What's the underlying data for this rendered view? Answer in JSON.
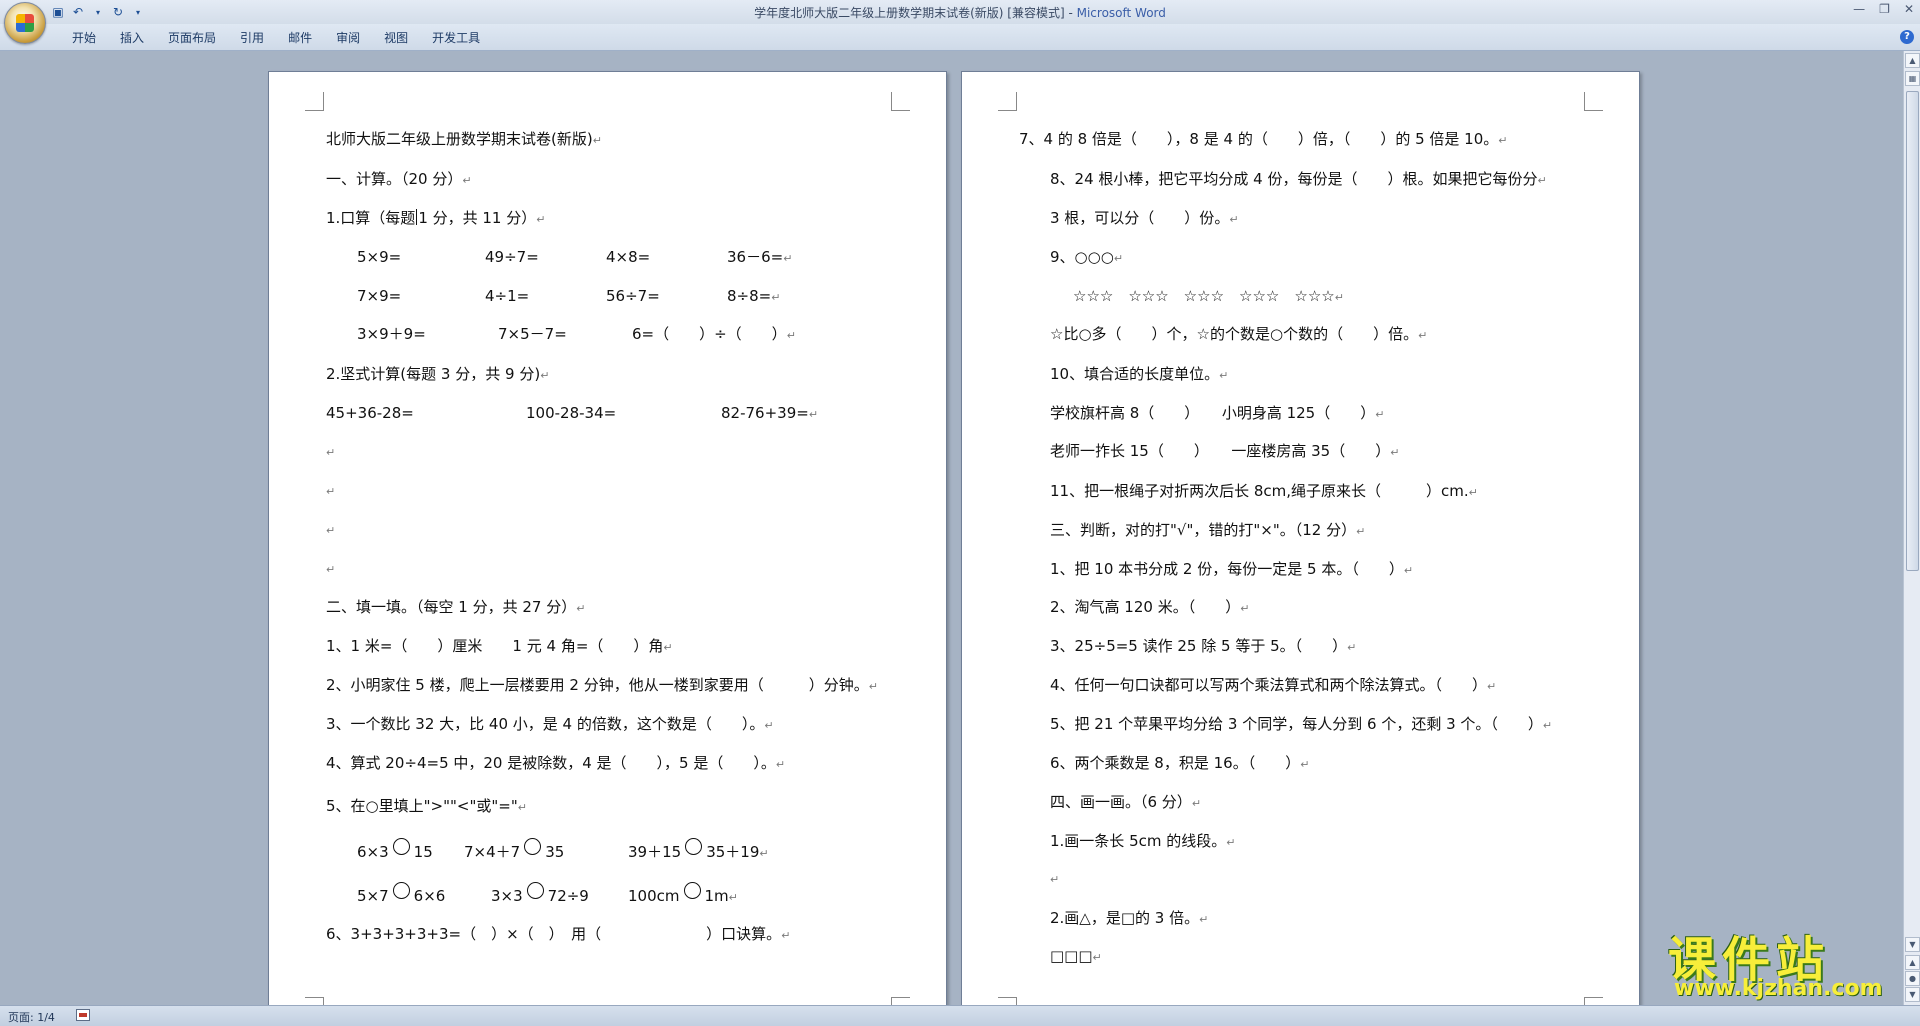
{
  "window": {
    "title": "学年度北师大版二年级上册数学期末试卷(新版) [兼容模式] - ",
    "app_name": "Microsoft Word",
    "quick_access": [
      "save-icon",
      "undo-icon",
      "redo-icon",
      "customize-icon"
    ]
  },
  "ribbon": {
    "tabs": [
      "开始",
      "插入",
      "页面布局",
      "引用",
      "邮件",
      "审阅",
      "视图",
      "开发工具"
    ]
  },
  "page1": {
    "title": "北师大版二年级上册数学期末试卷(新版)",
    "s1": "一、计算。（20 分）",
    "q1a": "1.口算（每题",
    "q1b": "1 分，共 11 分）",
    "r1": [
      "5×9=",
      "49÷7=",
      "4×8=",
      "36－6="
    ],
    "r2": [
      "7×9=",
      "4÷1=",
      "56÷7=",
      "8÷8="
    ],
    "r3": [
      "3×9＋9=",
      "7×5－7=",
      "6=（　　）÷（　　）"
    ],
    "q2": "2.坚式计算(每题 3 分，共 9 分)",
    "r4": [
      "45+36-28=",
      "100-28-34=",
      "82-76+39="
    ],
    "s2": "二、填一填。（每空 1 分，共 27 分）",
    "f1": "1、1 米=（　　）厘米　　1 元 4 角=（　　）角",
    "f2": "2、小明家住 5 楼，爬上一层楼要用 2 分钟，他从一楼到家要用（　　　）分钟。",
    "f3": "3、一个数比 32 大，比 40 小，是 4 的倍数，这个数是（　　）。",
    "f4": "4、算式 20÷4=5 中，20 是被除数，4 是（　　），5 是（　　）。",
    "f5": "5、在○里填上\">\"\"<\"或\"=\"",
    "c1": [
      "6×3",
      "15",
      "7×4＋7",
      "35",
      "39＋15",
      "35＋19"
    ],
    "c2": [
      "5×7",
      "6×6",
      "3×3",
      "72÷9",
      "100cm",
      "1m"
    ],
    "f6": "6、3+3+3+3+3=（　）×（　）　用（　　　　　　　）口诀算。"
  },
  "page2": {
    "l7": "7、4 的 8 倍是（　　），8 是 4 的（　　）倍，（　　）的 5 倍是 10。",
    "l8a": "8、24 根小棒，把它平均分成 4 份，每份是（　　）根。如果把它每份分",
    "l8b": "3 根，可以分（　　）份。",
    "l9": "9、○○○",
    "stars": "☆☆☆　☆☆☆　☆☆☆　☆☆☆　☆☆☆",
    "l9b": "☆比○多（　　）个，☆的个数是○个数的（　　）倍。",
    "l10": "10、填合适的长度单位。",
    "l10a": "学校旗杆高 8（　　）　　小明身高 125（　　）",
    "l10b": "老师一拃长 15（　　）　　一座楼房高 35（　　）",
    "l11": "11、把一根绳子对折两次后长 8cm,绳子原来长（　　　）cm.",
    "s3": "三、判断，对的打\"√\"，错的打\"×\"。（12 分）",
    "j1": "1、把 10 本书分成 2 份，每份一定是 5 本。（　　）",
    "j2": "2、淘气高 120 米。（　　）",
    "j3": "3、25÷5=5 读作 25 除 5 等于 5。（　　）",
    "j4": "4、任何一句口诀都可以写两个乘法算式和两个除法算式。（　　）",
    "j5": "5、把 21 个苹果平均分给 3 个同学，每人分到 6 个，还剩 3 个。（　　）",
    "j6": "6、两个乘数是 8，积是 16。（　　）",
    "s4": "四、画一画。（6 分）",
    "d1": "1.画一条长 5cm 的线段。",
    "d2": "2.画△，是□的 3 倍。",
    "d3": "□□□"
  },
  "paragraph_mark": "↵",
  "status": {
    "page": "页面: 1/4"
  },
  "watermark": {
    "main": "课件站",
    "url": "www.kjzhan.com"
  }
}
